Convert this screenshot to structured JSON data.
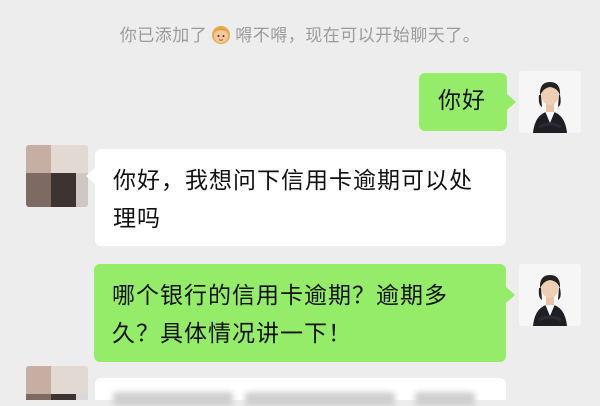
{
  "system_notice": {
    "prefix": "你已添加了",
    "suffix": "嘚不嘚，现在可以开始聊天了。",
    "emoji_icon": "blonde-child-face-icon"
  },
  "messages": [
    {
      "sender": "self",
      "text": "你好"
    },
    {
      "sender": "other",
      "text": "你好，我想问下信用卡逾期可以处理吗"
    },
    {
      "sender": "self",
      "text": "哪个银行的信用卡逾期？逾期多久？具体情况讲一下！"
    },
    {
      "sender": "other",
      "text": ""
    }
  ],
  "colors": {
    "background": "#ededed",
    "self_bubble": "#95ec69",
    "other_bubble": "#ffffff",
    "system_text": "#9b9b9b"
  }
}
